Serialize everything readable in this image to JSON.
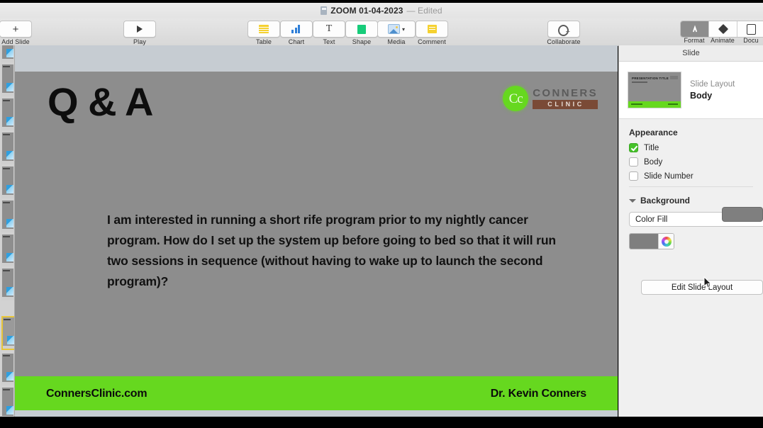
{
  "window": {
    "title": "ZOOM 01-04-2023",
    "edited_label": "— Edited",
    "doc_icon": "keynote-document-icon"
  },
  "toolbar": {
    "items": [
      {
        "label": "Add Slide",
        "icon": "plus-icon"
      },
      {
        "label": "Play",
        "icon": "play-icon"
      },
      {
        "label": "Table",
        "icon": "table-icon"
      },
      {
        "label": "Chart",
        "icon": "bar-chart-icon"
      },
      {
        "label": "Text",
        "icon": "text-icon"
      },
      {
        "label": "Shape",
        "icon": "shape-icon"
      },
      {
        "label": "Media",
        "icon": "media-icon"
      },
      {
        "label": "Comment",
        "icon": "comment-icon"
      },
      {
        "label": "Collaborate",
        "icon": "collaborate-icon"
      }
    ],
    "right_segments": [
      {
        "label": "Format",
        "icon": "format-brush-icon",
        "active": true
      },
      {
        "label": "Animate",
        "icon": "diamond-icon",
        "active": false
      },
      {
        "label": "Docu",
        "icon": "document-icon",
        "active": false
      }
    ]
  },
  "navigator": {
    "thumbnails": [
      {
        "selected": false
      },
      {
        "selected": false
      },
      {
        "selected": false
      },
      {
        "selected": false
      },
      {
        "selected": false
      },
      {
        "selected": false
      },
      {
        "selected": false
      },
      {
        "selected": true
      },
      {
        "selected": false
      },
      {
        "selected": false
      }
    ]
  },
  "slide": {
    "title": "Q & A",
    "logo": {
      "mark_text": "Cc",
      "name": "CONNERS",
      "sub": "CLINIC",
      "mark_color": "#66d81f",
      "sub_bg": "#7a4a36"
    },
    "body": "I am interested in running a short rife program prior to my nightly cancer program. How do I set up the system up before going to bed so that it will run two sessions in sequence (without having to wake up to launch the second program)?",
    "footer_left": "ConnersClinic.com",
    "footer_right": "Dr. Kevin Conners",
    "background_color": "#8d8d8d",
    "footer_color": "#66d81f"
  },
  "inspector": {
    "header": "Slide",
    "layout": {
      "label": "Slide Layout",
      "value": "Body",
      "thumb_title": "PRESENTATION TITLE"
    },
    "appearance": {
      "title": "Appearance",
      "options": [
        {
          "label": "Title",
          "checked": true
        },
        {
          "label": "Body",
          "checked": false
        },
        {
          "label": "Slide Number",
          "checked": false
        }
      ]
    },
    "background": {
      "title": "Background",
      "fill_type": "Color Fill",
      "color": "#7f7f7f"
    },
    "edit_layout_button": "Edit Slide Layout"
  }
}
